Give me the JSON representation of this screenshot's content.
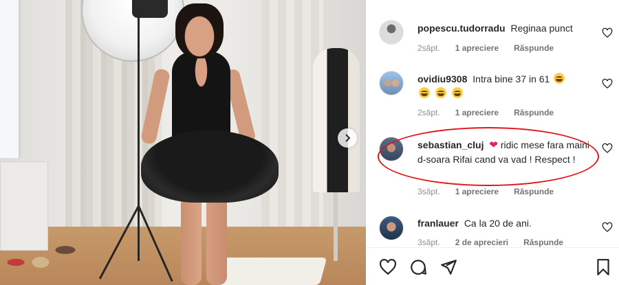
{
  "post_image": {
    "alt": ""
  },
  "carousel": {
    "next_icon": "chevron-right-icon"
  },
  "comments": [
    {
      "username": "popescu.tudorradu",
      "text": "Reginaa punct",
      "time": "2săpt.",
      "likes": "1 apreciere",
      "reply": "Răspunde"
    },
    {
      "username": "ovidiu9308",
      "text": "Intra bine 37 in 61",
      "time": "2săpt.",
      "likes": "1 apreciere",
      "reply": "Răspunde"
    },
    {
      "username": "sebastian_cluj",
      "text": "ridic mese fara maini d-soara Rifai cand va vad ! Respect !",
      "time": "3săpt.",
      "likes": "1 apreciere",
      "reply": "Răspunde"
    },
    {
      "username": "franlauer",
      "text": "Ca la 20 de ani.",
      "time": "3săpt.",
      "likes": "2 de aprecieri",
      "reply": "Răspunde"
    }
  ],
  "actions": {
    "like": "heart-icon",
    "comment": "comment-icon",
    "share": "share-icon",
    "save": "bookmark-icon"
  },
  "colors": {
    "highlight": "#e0141b",
    "text": "#262626",
    "muted": "#8e8e8e"
  }
}
